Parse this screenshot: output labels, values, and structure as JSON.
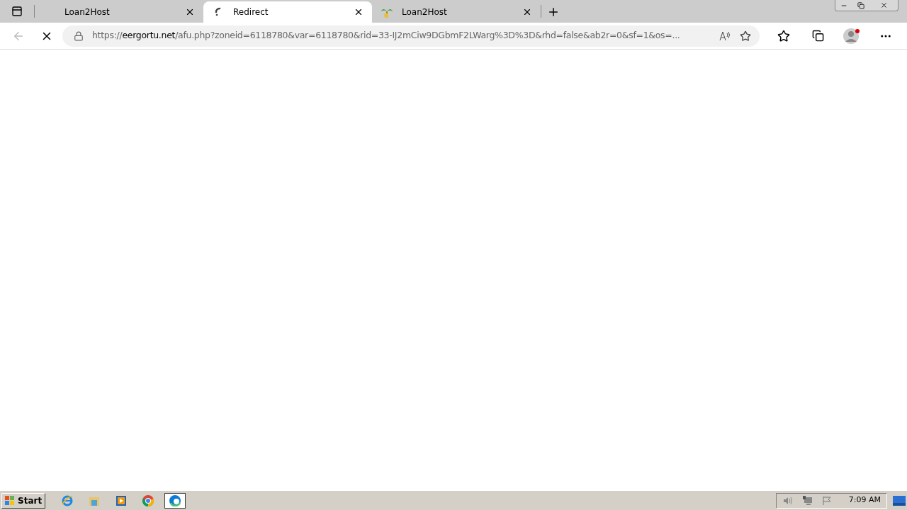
{
  "tabs": [
    {
      "title": "Loan2Host",
      "selected": false,
      "kind": "plain"
    },
    {
      "title": "Redirect",
      "selected": true,
      "kind": "loading"
    },
    {
      "title": "Loan2Host",
      "selected": false,
      "kind": "site"
    }
  ],
  "address_bar": {
    "scheme": "https://",
    "host": "eergortu.net",
    "path": "/afu.php?zoneid=6118780&var=6118780&rid=33-IJ2mCiw9DGbmF2LWarg%3D%3D&rhd=false&ab2r=0&sf=1&os=..."
  },
  "loading": true,
  "taskbar": {
    "start": "Start",
    "apps": [
      {
        "kind": "ie",
        "active": false
      },
      {
        "kind": "folder",
        "active": false
      },
      {
        "kind": "media",
        "active": false
      },
      {
        "kind": "chrome",
        "active": false
      },
      {
        "kind": "edge",
        "active": true
      }
    ],
    "clock": "7:09 AM"
  }
}
